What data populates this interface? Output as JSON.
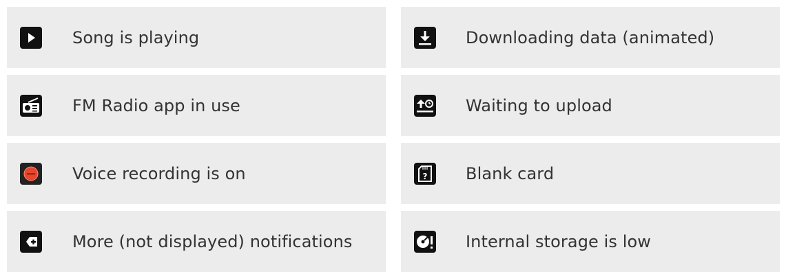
{
  "left_column": [
    {
      "icon": "play-icon",
      "label": "Song is playing"
    },
    {
      "icon": "fm-radio-icon",
      "label": "FM Radio app in use"
    },
    {
      "icon": "voice-recording-icon",
      "label": "Voice recording is on"
    },
    {
      "icon": "more-notifications-icon",
      "label": "More (not displayed) notifications"
    }
  ],
  "right_column": [
    {
      "icon": "download-icon",
      "label": "Downloading data (animated)"
    },
    {
      "icon": "waiting-upload-icon",
      "label": "Waiting to upload"
    },
    {
      "icon": "blank-card-icon",
      "label": "Blank card"
    },
    {
      "icon": "storage-low-icon",
      "label": "Internal storage is low"
    }
  ],
  "colors": {
    "row_background": "#ececec",
    "text": "#333333",
    "icon_dark": "#111111",
    "recording_red": "#e8452c"
  }
}
